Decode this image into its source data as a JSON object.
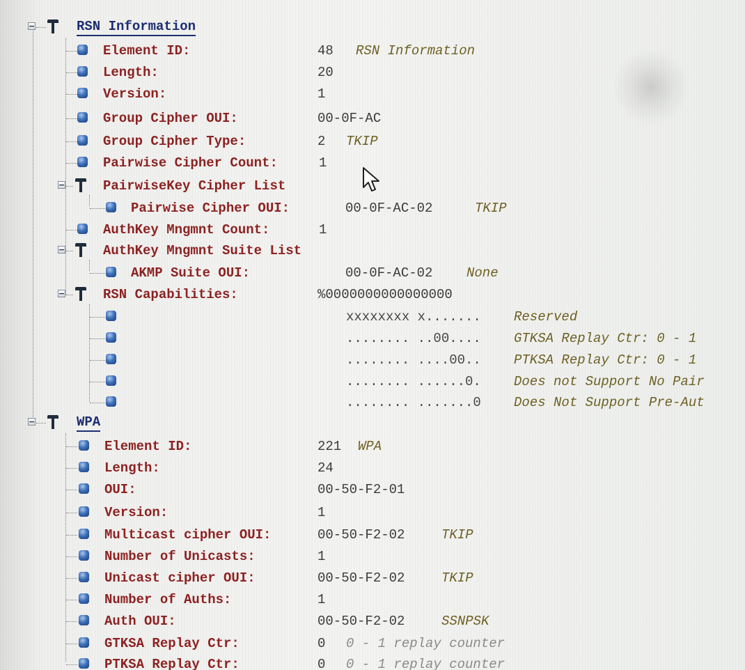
{
  "rsn": {
    "title": "RSN Information",
    "element_id": {
      "label": "Element ID:",
      "value": "48",
      "desc": "RSN Information"
    },
    "length": {
      "label": "Length:",
      "value": "20"
    },
    "version": {
      "label": "Version:",
      "value": "1"
    },
    "group_cipher_oui": {
      "label": "Group Cipher OUI:",
      "value": "00-0F-AC"
    },
    "group_cipher_type": {
      "label": "Group Cipher Type:",
      "value": "2",
      "desc": "TKIP"
    },
    "pairwise_cipher_count": {
      "label": "Pairwise Cipher Count:",
      "value": "1"
    },
    "pairwise_key_cipher_list": {
      "label": "PairwiseKey Cipher List",
      "pairwise_cipher_oui": {
        "label": "Pairwise Cipher OUI:",
        "value": "00-0F-AC-02",
        "desc": "TKIP"
      }
    },
    "authkey_mngmnt_count": {
      "label": "AuthKey Mngmnt Count:",
      "value": "1"
    },
    "authkey_mngmnt_suite_list": {
      "label": "AuthKey Mngmnt Suite List",
      "akmp_suite_oui": {
        "label": "AKMP Suite OUI:",
        "value": "00-0F-AC-02",
        "desc": "None"
      }
    },
    "rsn_capabilities": {
      "label": "RSN Capabilities:",
      "value": "%0000000000000000",
      "bits": [
        {
          "pattern": "xxxxxxxx x.......",
          "desc": "Reserved"
        },
        {
          "pattern": "........ ..00....",
          "desc": "GTKSA Replay Ctr: 0 - 1"
        },
        {
          "pattern": "........ ....00..",
          "desc": "PTKSA Replay Ctr: 0 - 1"
        },
        {
          "pattern": "........ ......0.",
          "desc": "Does not Support No Pair"
        },
        {
          "pattern": "........ .......0",
          "desc": "Does Not Support Pre-Aut"
        }
      ]
    }
  },
  "wpa": {
    "title": "WPA",
    "element_id": {
      "label": "Element ID:",
      "value": "221",
      "desc": "WPA"
    },
    "length": {
      "label": "Length:",
      "value": "24"
    },
    "oui": {
      "label": "OUI:",
      "value": "00-50-F2-01"
    },
    "version": {
      "label": "Version:",
      "value": "1"
    },
    "multicast_cipher_oui": {
      "label": "Multicast cipher OUI:",
      "value": "00-50-F2-02",
      "desc": "TKIP"
    },
    "number_of_unicasts": {
      "label": "Number of Unicasts:",
      "value": "1"
    },
    "unicast_cipher_oui": {
      "label": "Unicast cipher OUI:",
      "value": "00-50-F2-02",
      "desc": "TKIP"
    },
    "number_of_auths": {
      "label": "Number of Auths:",
      "value": "1"
    },
    "auth_oui": {
      "label": "Auth OUI:",
      "value": "00-50-F2-02",
      "desc": "SSNPSK"
    },
    "gtksa_replay_ctr": {
      "label": "GTKSA Replay Ctr:",
      "value": "0",
      "desc": "0 - 1 replay counter"
    },
    "ptksa_replay_ctr": {
      "label": "PTKSA Replay Ctr:",
      "value": "0",
      "desc": "0 - 1 replay counter"
    }
  },
  "icons": {
    "expand_toggle": "minus-box-icon",
    "group_node": "tree-group-icon",
    "field_node": "field-cube-icon",
    "pointer": "mouse-pointer-icon"
  },
  "colors": {
    "field_label": "#8c2222",
    "section_title": "#1d2d72",
    "value": "#3b3b3b",
    "description": "#6e6024",
    "node_icon": "#3e6fb8"
  }
}
